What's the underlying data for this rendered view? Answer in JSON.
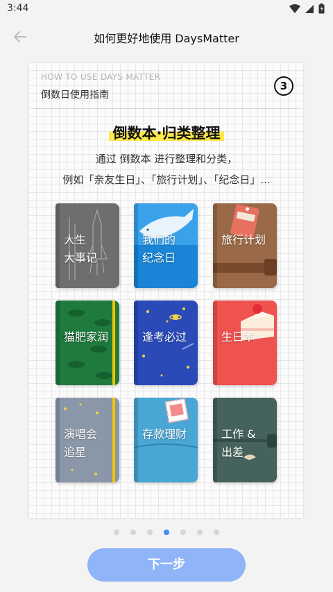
{
  "status_bar": {
    "time": "3:44"
  },
  "header": {
    "title": "如何更好地使用 DaysMatter"
  },
  "card": {
    "subtitle": "HOW TO USE DAYS MATTER",
    "title": "倒数日使用指南",
    "step": "3",
    "feature_title": "倒数本·归类整理",
    "desc_line1": "通过 倒数本 进行整理和分类，",
    "desc_line2": "例如「亲友生日」、「旅行计划」、「纪念日」..."
  },
  "books": [
    {
      "label": "人生\n大事记",
      "color": "#6e6e6e",
      "icon": "rocket-sketch"
    },
    {
      "label": "我们的\n纪念日",
      "color": "#1a84d6",
      "icon": "whale"
    },
    {
      "label": "旅行计划",
      "color": "#8a5a3a",
      "icon": "luggage-tag"
    },
    {
      "label": "猫肥家润",
      "color": "#1f7a3d",
      "icon": "dinosaur-pattern"
    },
    {
      "label": "逢考必过",
      "color": "#2a4ab8",
      "icon": "stars-planets"
    },
    {
      "label": "生日本",
      "color": "#f0524f",
      "icon": "cake"
    },
    {
      "label": "演唱会\n追星",
      "color": "#8a97a8",
      "icon": "stars"
    },
    {
      "label": "存款理财",
      "color": "#3a97c9",
      "icon": "stamp"
    },
    {
      "label": "工作 &\n出差",
      "color": "#3e5a54",
      "icon": "bird"
    }
  ],
  "pager": {
    "count": 7,
    "active_index": 3
  },
  "next_button": {
    "label": "下一步"
  },
  "colors": {
    "accent": "#4a8cf6",
    "button": "#8fb4f8",
    "highlight": "#fde84a"
  }
}
